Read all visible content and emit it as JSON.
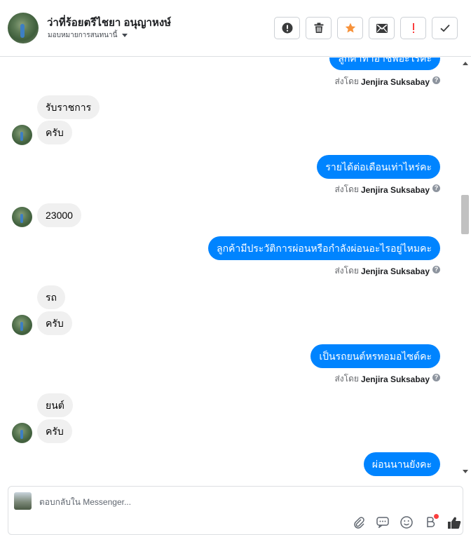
{
  "header": {
    "contact_name": "ว่าที่ร้อยตรีไชยา อนุญาหงษ์",
    "assign_label": "มอบหมายการสนทนานี้",
    "actions": [
      {
        "name": "report-button",
        "icon": "exclamation-circle-icon"
      },
      {
        "name": "delete-button",
        "icon": "trash-icon"
      },
      {
        "name": "star-button",
        "icon": "star-icon",
        "color": "#f7923a"
      },
      {
        "name": "email-button",
        "icon": "envelope-icon"
      },
      {
        "name": "important-button",
        "icon": "exclamation-icon",
        "color": "#fa3e3e"
      },
      {
        "name": "done-button",
        "icon": "check-icon"
      }
    ]
  },
  "conversation": {
    "sent_by_prefix": "ส่งโดย",
    "agent_name": "Jenjira Suksabay",
    "messages": [
      {
        "dir": "out",
        "text": "ลูกค้าทำอาชีพอะไรคะ"
      },
      {
        "dir": "in",
        "text": "รับราชการ"
      },
      {
        "dir": "in",
        "text": "ครับ"
      },
      {
        "dir": "out",
        "text": "รายได้ต่อเดือนเท่าไหร่คะ"
      },
      {
        "dir": "in",
        "text": "23000"
      },
      {
        "dir": "out",
        "text": "ลูกค้ามีประวัติการผ่อนหรือกำลังผ่อนอะไรอยู่ไหมคะ"
      },
      {
        "dir": "in",
        "text": "รถ"
      },
      {
        "dir": "in",
        "text": "ครับ"
      },
      {
        "dir": "out",
        "text": "เป็นรถยนต์หรทอมอไซต์คะ"
      },
      {
        "dir": "in",
        "text": "ยนต์"
      },
      {
        "dir": "in",
        "text": "ครับ"
      },
      {
        "dir": "out",
        "text": "ผ่อนนานยังคะ"
      }
    ]
  },
  "reply": {
    "placeholder": "ตอบกลับใน Messenger...",
    "tools": [
      "paperclip-icon",
      "saved-replies-icon",
      "emoji-icon",
      "shop-icon",
      "like-icon"
    ]
  },
  "colors": {
    "outgoing_bubble": "#0084ff",
    "incoming_bubble": "#f0f0f0",
    "star": "#f7923a",
    "alert": "#fa3e3e"
  }
}
